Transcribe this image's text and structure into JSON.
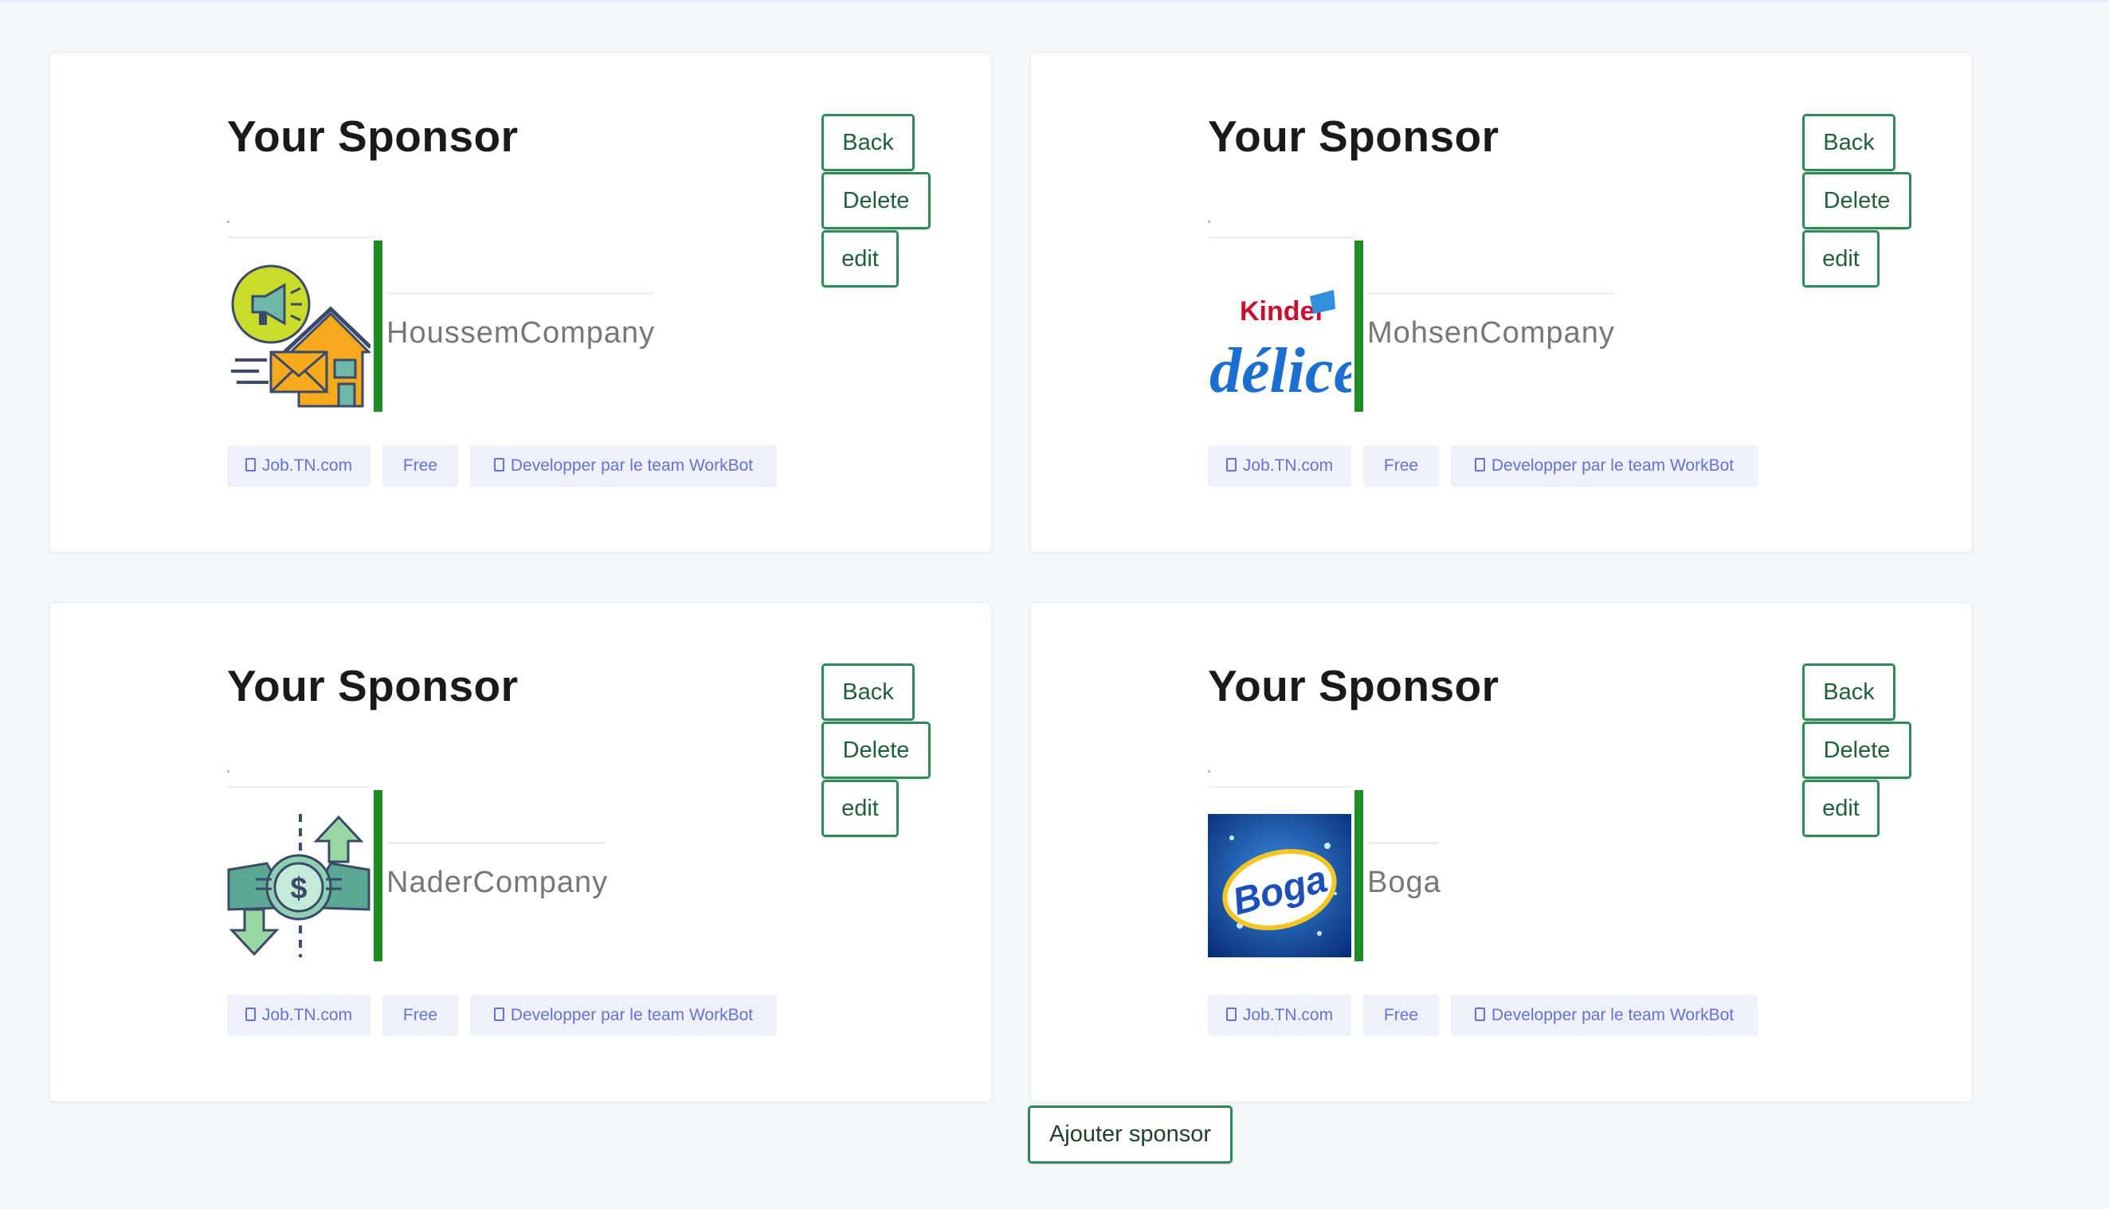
{
  "sponsors": [
    {
      "title": "Your Sponsor",
      "company": "HoussemCompany",
      "logo": "megaphone-house-mail-icon",
      "buttons": {
        "back": "Back",
        "delete": "Delete",
        "edit": "edit"
      },
      "tags": [
        "Job.TN.com",
        "Free",
        "Developper par le team WorkBot"
      ]
    },
    {
      "title": "Your Sponsor",
      "company": "MohsenCompany",
      "logo": "kinder-delice-logo",
      "logo_text": {
        "top": "Kinder",
        "bottom": "délice"
      },
      "buttons": {
        "back": "Back",
        "delete": "Delete",
        "edit": "edit"
      },
      "tags": [
        "Job.TN.com",
        "Free",
        "Developper par le team WorkBot"
      ]
    },
    {
      "title": "Your Sponsor",
      "company": "NaderCompany",
      "logo": "money-transfer-icon",
      "buttons": {
        "back": "Back",
        "delete": "Delete",
        "edit": "edit"
      },
      "tags": [
        "Job.TN.com",
        "Free",
        "Developper par le team WorkBot"
      ]
    },
    {
      "title": "Your Sponsor",
      "company": "Boga",
      "logo": "boga-logo",
      "logo_text": "Boga",
      "buttons": {
        "back": "Back",
        "delete": "Delete",
        "edit": "edit"
      },
      "tags": [
        "Job.TN.com",
        "Free",
        "Developper par le team WorkBot"
      ]
    }
  ],
  "add_button": "Ajouter sponsor",
  "colors": {
    "accent_green": "#1e8b24",
    "button_border": "#2e8b57",
    "tag_text": "#6671d8",
    "tag_bg": "#eef0fa",
    "page_bg": "#f4f7fb"
  }
}
